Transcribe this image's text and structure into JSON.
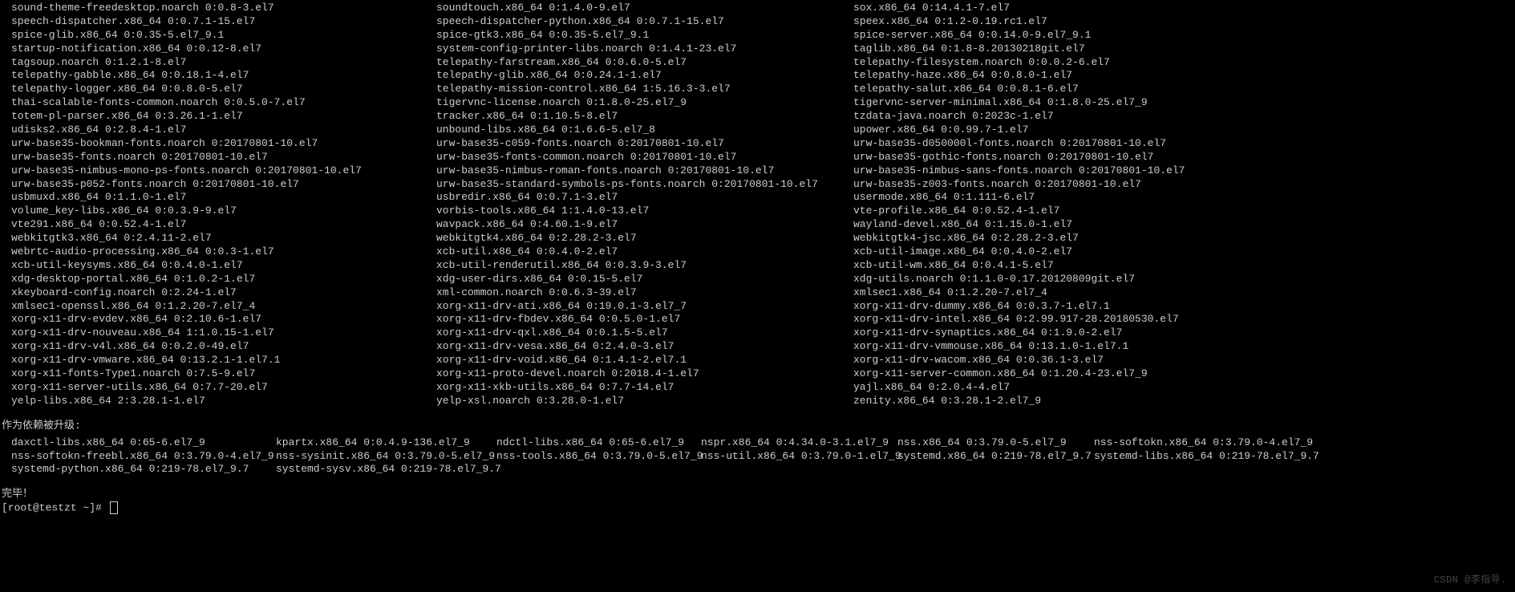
{
  "columns": [
    [
      "sound-theme-freedesktop.noarch 0:0.8-3.el7",
      "speech-dispatcher.x86_64 0:0.7.1-15.el7",
      "spice-glib.x86_64 0:0.35-5.el7_9.1",
      "startup-notification.x86_64 0:0.12-8.el7",
      "tagsoup.noarch 0:1.2.1-8.el7",
      "telepathy-gabble.x86_64 0:0.18.1-4.el7",
      "telepathy-logger.x86_64 0:0.8.0-5.el7",
      "thai-scalable-fonts-common.noarch 0:0.5.0-7.el7",
      "totem-pl-parser.x86_64 0:3.26.1-1.el7",
      "udisks2.x86_64 0:2.8.4-1.el7",
      "urw-base35-bookman-fonts.noarch 0:20170801-10.el7",
      "urw-base35-fonts.noarch 0:20170801-10.el7",
      "urw-base35-nimbus-mono-ps-fonts.noarch 0:20170801-10.el7",
      "urw-base35-p052-fonts.noarch 0:20170801-10.el7",
      "usbmuxd.x86_64 0:1.1.0-1.el7",
      "volume_key-libs.x86_64 0:0.3.9-9.el7",
      "vte291.x86_64 0:0.52.4-1.el7",
      "webkitgtk3.x86_64 0:2.4.11-2.el7",
      "webrtc-audio-processing.x86_64 0:0.3-1.el7",
      "xcb-util-keysyms.x86_64 0:0.4.0-1.el7",
      "xdg-desktop-portal.x86_64 0:1.0.2-1.el7",
      "xkeyboard-config.noarch 0:2.24-1.el7",
      "xmlsec1-openssl.x86_64 0:1.2.20-7.el7_4",
      "xorg-x11-drv-evdev.x86_64 0:2.10.6-1.el7",
      "xorg-x11-drv-nouveau.x86_64 1:1.0.15-1.el7",
      "xorg-x11-drv-v4l.x86_64 0:0.2.0-49.el7",
      "xorg-x11-drv-vmware.x86_64 0:13.2.1-1.el7.1",
      "xorg-x11-fonts-Type1.noarch 0:7.5-9.el7",
      "xorg-x11-server-utils.x86_64 0:7.7-20.el7",
      "yelp-libs.x86_64 2:3.28.1-1.el7"
    ],
    [
      "soundtouch.x86_64 0:1.4.0-9.el7",
      "speech-dispatcher-python.x86_64 0:0.7.1-15.el7",
      "spice-gtk3.x86_64 0:0.35-5.el7_9.1",
      "system-config-printer-libs.noarch 0:1.4.1-23.el7",
      "telepathy-farstream.x86_64 0:0.6.0-5.el7",
      "telepathy-glib.x86_64 0:0.24.1-1.el7",
      "telepathy-mission-control.x86_64 1:5.16.3-3.el7",
      "tigervnc-license.noarch 0:1.8.0-25.el7_9",
      "tracker.x86_64 0:1.10.5-8.el7",
      "unbound-libs.x86_64 0:1.6.6-5.el7_8",
      "urw-base35-c059-fonts.noarch 0:20170801-10.el7",
      "urw-base35-fonts-common.noarch 0:20170801-10.el7",
      "urw-base35-nimbus-roman-fonts.noarch 0:20170801-10.el7",
      "urw-base35-standard-symbols-ps-fonts.noarch 0:20170801-10.el7",
      "usbredir.x86_64 0:0.7.1-3.el7",
      "vorbis-tools.x86_64 1:1.4.0-13.el7",
      "wavpack.x86_64 0:4.60.1-9.el7",
      "webkitgtk4.x86_64 0:2.28.2-3.el7",
      "xcb-util.x86_64 0:0.4.0-2.el7",
      "xcb-util-renderutil.x86_64 0:0.3.9-3.el7",
      "xdg-user-dirs.x86_64 0:0.15-5.el7",
      "xml-common.noarch 0:0.6.3-39.el7",
      "xorg-x11-drv-ati.x86_64 0:19.0.1-3.el7_7",
      "xorg-x11-drv-fbdev.x86_64 0:0.5.0-1.el7",
      "xorg-x11-drv-qxl.x86_64 0:0.1.5-5.el7",
      "xorg-x11-drv-vesa.x86_64 0:2.4.0-3.el7",
      "xorg-x11-drv-void.x86_64 0:1.4.1-2.el7.1",
      "xorg-x11-proto-devel.noarch 0:2018.4-1.el7",
      "xorg-x11-xkb-utils.x86_64 0:7.7-14.el7",
      "yelp-xsl.noarch 0:3.28.0-1.el7"
    ],
    [
      "sox.x86_64 0:14.4.1-7.el7",
      "speex.x86_64 0:1.2-0.19.rc1.el7",
      "spice-server.x86_64 0:0.14.0-9.el7_9.1",
      "taglib.x86_64 0:1.8-8.20130218git.el7",
      "telepathy-filesystem.noarch 0:0.0.2-6.el7",
      "telepathy-haze.x86_64 0:0.8.0-1.el7",
      "telepathy-salut.x86_64 0:0.8.1-6.el7",
      "tigervnc-server-minimal.x86_64 0:1.8.0-25.el7_9",
      "tzdata-java.noarch 0:2023c-1.el7",
      "upower.x86_64 0:0.99.7-1.el7",
      "urw-base35-d050000l-fonts.noarch 0:20170801-10.el7",
      "urw-base35-gothic-fonts.noarch 0:20170801-10.el7",
      "urw-base35-nimbus-sans-fonts.noarch 0:20170801-10.el7",
      "urw-base35-z003-fonts.noarch 0:20170801-10.el7",
      "usermode.x86_64 0:1.111-6.el7",
      "vte-profile.x86_64 0:0.52.4-1.el7",
      "wayland-devel.x86_64 0:1.15.0-1.el7",
      "webkitgtk4-jsc.x86_64 0:2.28.2-3.el7",
      "xcb-util-image.x86_64 0:0.4.0-2.el7",
      "xcb-util-wm.x86_64 0:0.4.1-5.el7",
      "xdg-utils.noarch 0:1.1.0-0.17.20120809git.el7",
      "xmlsec1.x86_64 0:1.2.20-7.el7_4",
      "xorg-x11-drv-dummy.x86_64 0:0.3.7-1.el7.1",
      "xorg-x11-drv-intel.x86_64 0:2.99.917-28.20180530.el7",
      "xorg-x11-drv-synaptics.x86_64 0:1.9.0-2.el7",
      "xorg-x11-drv-vmmouse.x86_64 0:13.1.0-1.el7.1",
      "xorg-x11-drv-wacom.x86_64 0:0.36.1-3.el7",
      "xorg-x11-server-common.x86_64 0:1.20.4-23.el7_9",
      "yajl.x86_64 0:2.0.4-4.el7",
      "zenity.x86_64 0:3.28.1-2.el7_9"
    ]
  ],
  "section_label": "作为依赖被升级:",
  "deps": [
    "daxctl-libs.x86_64 0:65-6.el7_9",
    "kpartx.x86_64 0:0.4.9-136.el7_9",
    "ndctl-libs.x86_64 0:65-6.el7_9",
    "nspr.x86_64 0:4.34.0-3.1.el7_9",
    "nss.x86_64 0:3.79.0-5.el7_9",
    "nss-softokn.x86_64 0:3.79.0-4.el7_9",
    "nss-softokn-freebl.x86_64 0:3.79.0-4.el7_9",
    "nss-sysinit.x86_64 0:3.79.0-5.el7_9",
    "nss-tools.x86_64 0:3.79.0-5.el7_9",
    "nss-util.x86_64 0:3.79.0-1.el7_9",
    "systemd.x86_64 0:219-78.el7_9.7",
    "systemd-libs.x86_64 0:219-78.el7_9.7",
    "systemd-python.x86_64 0:219-78.el7_9.7",
    "systemd-sysv.x86_64 0:219-78.el7_9.7"
  ],
  "deps_widths": [
    330,
    275,
    255,
    245,
    245,
    330,
    330,
    275,
    255,
    245,
    245,
    330,
    330,
    275
  ],
  "complete_label": "完毕！",
  "prompt": "[root@testzt ~]# ",
  "watermark": "CSDN @李指导."
}
